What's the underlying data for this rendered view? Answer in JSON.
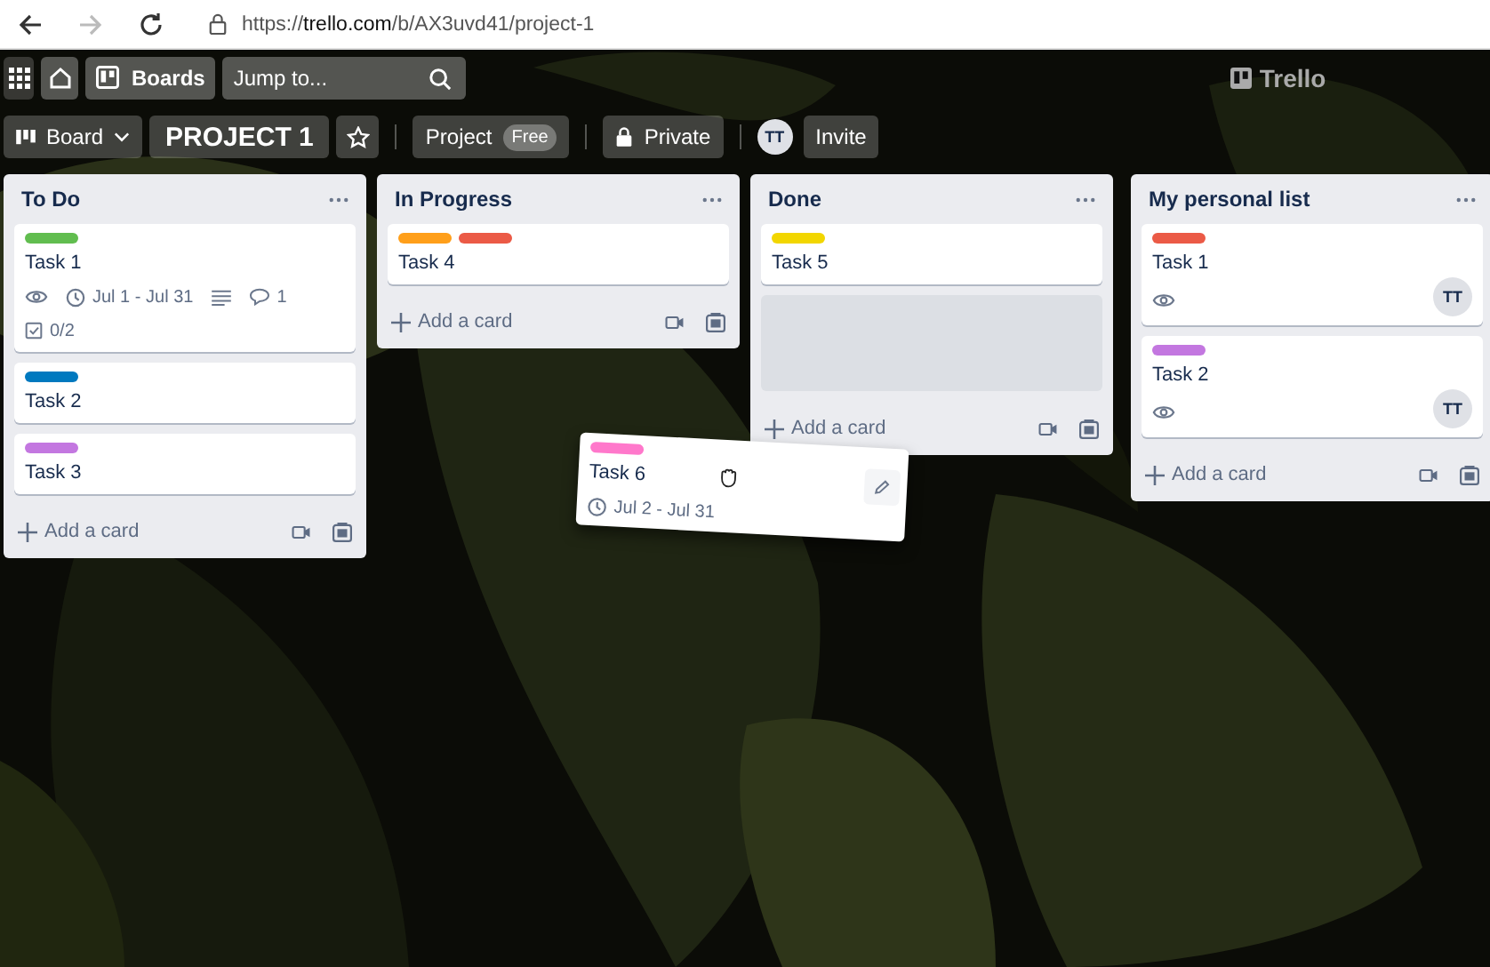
{
  "browser": {
    "url": "https://**trello.com**/b/AX3uvd41/project-1"
  },
  "top_nav": {
    "boards_label": "Boards",
    "search": {
      "placeholder": "Jump to..."
    },
    "logo": "Trello"
  },
  "board_header": {
    "view": "Board",
    "title": "PROJECT 1",
    "starred": false,
    "workspace": "Project",
    "plan": "Free",
    "visibility": "Private",
    "member_initials": "TT",
    "invite": "Invite"
  },
  "lists": [
    {
      "title": "To Do",
      "add_label": "Add a card",
      "cards": [
        {
          "kind": "card",
          "labels": [
            {
              "color": "#61bd4f"
            }
          ],
          "title": "Task 1",
          "watching": true,
          "due": "Jul 1 - Jul 31",
          "description": true,
          "comments": "1",
          "checklist": "0/2"
        },
        {
          "kind": "card",
          "labels": [
            {
              "color": "#0079bf"
            }
          ],
          "title": "Task 2"
        },
        {
          "kind": "card",
          "labels": [
            {
              "color": "#c377e0"
            }
          ],
          "title": "Task 3"
        }
      ]
    },
    {
      "title": "In Progress",
      "add_label": "Add a card",
      "cards": [
        {
          "kind": "card",
          "labels": [
            {
              "color": "#ff9f1a"
            },
            {
              "color": "#eb5a46"
            }
          ],
          "title": "Task 4"
        }
      ]
    },
    {
      "title": "Done",
      "add_label": "Add a card",
      "cards": [
        {
          "kind": "card",
          "labels": [
            {
              "color": "#f2d600"
            }
          ],
          "title": "Task 5"
        },
        {
          "kind": "placeholder"
        }
      ]
    },
    {
      "title": "My personal list",
      "add_label": "Add a card",
      "cards": [
        {
          "kind": "card",
          "labels": [
            {
              "color": "#eb5a46"
            }
          ],
          "title": "Task 1",
          "watching": true,
          "member": "TT"
        },
        {
          "kind": "card",
          "labels": [
            {
              "color": "#c377e0"
            }
          ],
          "title": "Task 2",
          "watching": true,
          "member": "TT"
        }
      ]
    }
  ],
  "dragging_card": {
    "labels": [
      {
        "color": "#ff78cb"
      }
    ],
    "title": "Task 6",
    "due": "Jul 2 - Jul 31"
  }
}
